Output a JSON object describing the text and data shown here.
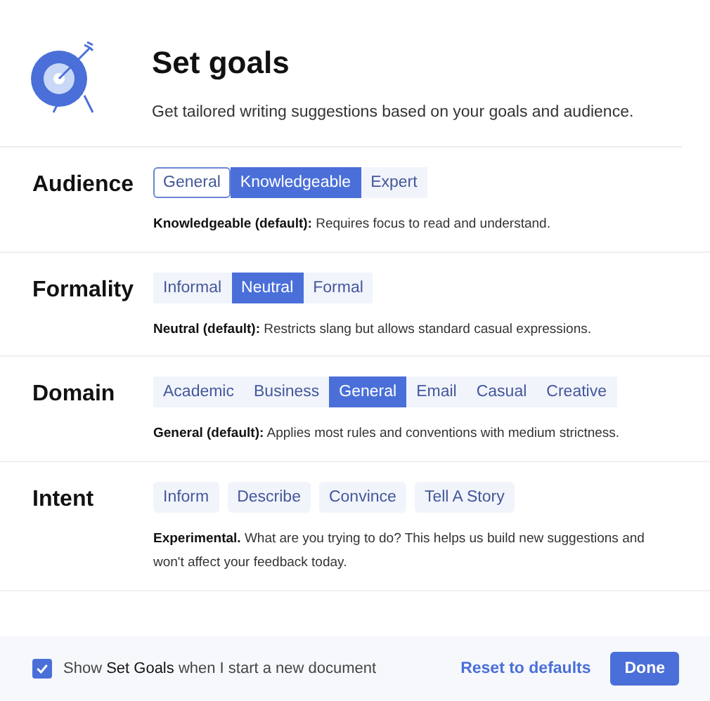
{
  "header": {
    "title": "Set goals",
    "subtitle": "Get tailored writing suggestions based on your goals and audience."
  },
  "sections": [
    {
      "label": "Audience",
      "kind": "segmented",
      "options": [
        {
          "label": "General",
          "selected": false,
          "focused": true
        },
        {
          "label": "Knowledgeable",
          "selected": true,
          "focused": false
        },
        {
          "label": "Expert",
          "selected": false,
          "focused": false
        }
      ],
      "description": "**Knowledgeable (default):** Requires focus to read and understand."
    },
    {
      "label": "Formality",
      "kind": "segmented",
      "options": [
        {
          "label": "Informal",
          "selected": false
        },
        {
          "label": "Neutral",
          "selected": true
        },
        {
          "label": "Formal",
          "selected": false
        }
      ],
      "description": "**Neutral (default):** Restricts slang but allows standard casual expressions."
    },
    {
      "label": "Domain",
      "kind": "segmented",
      "options": [
        {
          "label": "Academic",
          "selected": false
        },
        {
          "label": "Business",
          "selected": false
        },
        {
          "label": "General",
          "selected": true
        },
        {
          "label": "Email",
          "selected": false
        },
        {
          "label": "Casual",
          "selected": false
        },
        {
          "label": "Creative",
          "selected": false
        }
      ],
      "description": "**General (default):** Applies most rules and conventions with medium strictness."
    },
    {
      "label": "Intent",
      "kind": "chips",
      "options": [
        {
          "label": "Inform",
          "selected": false
        },
        {
          "label": "Describe",
          "selected": false
        },
        {
          "label": "Convince",
          "selected": false
        },
        {
          "label": "Tell A Story",
          "selected": false
        }
      ],
      "description": "**Experimental.** What are you trying to do? This helps us build new suggestions and won't affect your feedback today."
    }
  ],
  "footer": {
    "checkbox": {
      "label": "Show **Set Goals** when I start a new document",
      "checked": true
    },
    "reset": "Reset to defaults",
    "done": "Done"
  }
}
